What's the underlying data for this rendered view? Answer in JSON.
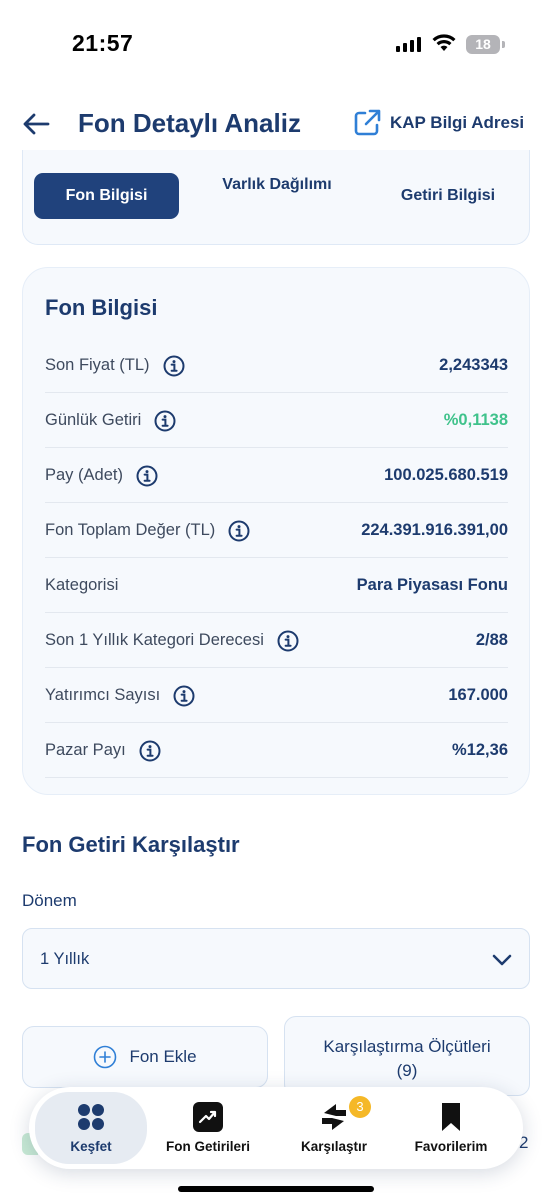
{
  "status_bar": {
    "time": "21:57",
    "battery": "18"
  },
  "header": {
    "back_icon": "arrow-left-icon",
    "title": "Fon Detaylı Analiz",
    "kap_link": "KAP Bilgi Adresi",
    "kap_icon": "external-link-icon"
  },
  "tabs": [
    {
      "label": "Fon Bilgisi",
      "active": true
    },
    {
      "label": "Varlık Dağılımı",
      "active": false
    },
    {
      "label": "Getiri Bilgisi",
      "active": false
    }
  ],
  "fund_info": {
    "title": "Fon Bilgisi",
    "rows": [
      {
        "label": "Son Fiyat (TL)",
        "value": "2,243343",
        "info": true
      },
      {
        "label": "Günlük Getiri",
        "value": "%0,1138",
        "info": true,
        "positive": true
      },
      {
        "label": "Pay (Adet)",
        "value": "100.025.680.519",
        "info": true
      },
      {
        "label": "Fon Toplam Değer (TL)",
        "value": "224.391.916.391,00",
        "info": true
      },
      {
        "label": "Kategorisi",
        "value": "Para Piyasası Fonu",
        "info": false
      },
      {
        "label": "Son 1 Yıllık Kategori Derecesi",
        "value": "2/88",
        "info": true
      },
      {
        "label": "Yatırımcı Sayısı",
        "value": "167.000",
        "info": true
      },
      {
        "label": "Pazar Payı",
        "value": "%12,36",
        "info": true
      }
    ]
  },
  "compare": {
    "title": "Fon Getiri Karşılaştır",
    "period_label": "Dönem",
    "period_value": "1 Yıllık",
    "add_fund": "Fon Ekle",
    "criteria_line1": "Karşılaştırma Ölçütleri",
    "criteria_line2": "(9)",
    "peek_right": "2"
  },
  "nav": [
    {
      "label": "Keşfet",
      "icon": "grid-dots-icon",
      "active": true
    },
    {
      "label": "Fon Getirileri",
      "icon": "trend-chart-icon",
      "active": false
    },
    {
      "label": "Karşılaştır",
      "icon": "swap-arrows-icon",
      "active": false,
      "badge": "3"
    },
    {
      "label": "Favorilerim",
      "icon": "bookmark-icon",
      "active": false
    }
  ],
  "colors": {
    "primary": "#1d3b6e",
    "active_tab": "#20427c",
    "positive": "#3fc28b",
    "badge": "#f5b827",
    "card_bg": "#f6f9fd"
  }
}
